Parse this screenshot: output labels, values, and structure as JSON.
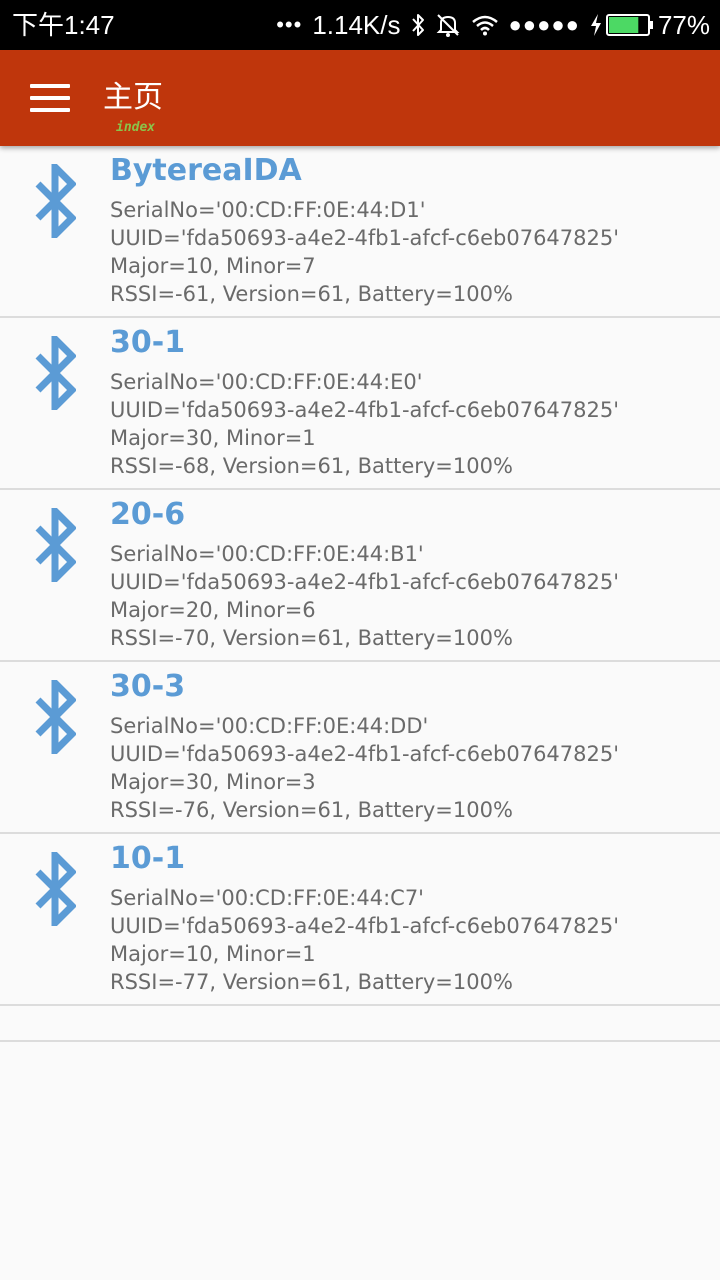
{
  "status_bar": {
    "time": "下午1:47",
    "dots": "•••",
    "speed": "1.14K/s",
    "signal": "●●●●●",
    "battery": "77%",
    "battery_level": 0.77
  },
  "app_bar": {
    "title": "主页",
    "subtitle": "index"
  },
  "colors": {
    "app_bar": "#bf360c",
    "device_name": "#5b9bd5",
    "bluetooth_icon": "#5b9bd5",
    "battery_fill": "#4cd964"
  },
  "devices": [
    {
      "name": "BytereaIDA",
      "serial": "SerialNo='00:CD:FF:0E:44:D1'",
      "uuid": "UUID='fda50693-a4e2-4fb1-afcf-c6eb07647825'",
      "major_minor": "Major=10, Minor=7",
      "rssi": "RSSI=-61, Version=61, Battery=100%"
    },
    {
      "name": "30-1",
      "serial": "SerialNo='00:CD:FF:0E:44:E0'",
      "uuid": "UUID='fda50693-a4e2-4fb1-afcf-c6eb07647825'",
      "major_minor": "Major=30, Minor=1",
      "rssi": "RSSI=-68, Version=61, Battery=100%"
    },
    {
      "name": "20-6",
      "serial": "SerialNo='00:CD:FF:0E:44:B1'",
      "uuid": "UUID='fda50693-a4e2-4fb1-afcf-c6eb07647825'",
      "major_minor": "Major=20, Minor=6",
      "rssi": "RSSI=-70, Version=61, Battery=100%"
    },
    {
      "name": "30-3",
      "serial": "SerialNo='00:CD:FF:0E:44:DD'",
      "uuid": "UUID='fda50693-a4e2-4fb1-afcf-c6eb07647825'",
      "major_minor": "Major=30, Minor=3",
      "rssi": "RSSI=-76, Version=61, Battery=100%"
    },
    {
      "name": "10-1",
      "serial": "SerialNo='00:CD:FF:0E:44:C7'",
      "uuid": "UUID='fda50693-a4e2-4fb1-afcf-c6eb07647825'",
      "major_minor": "Major=10, Minor=1",
      "rssi": "RSSI=-77, Version=61, Battery=100%"
    }
  ]
}
